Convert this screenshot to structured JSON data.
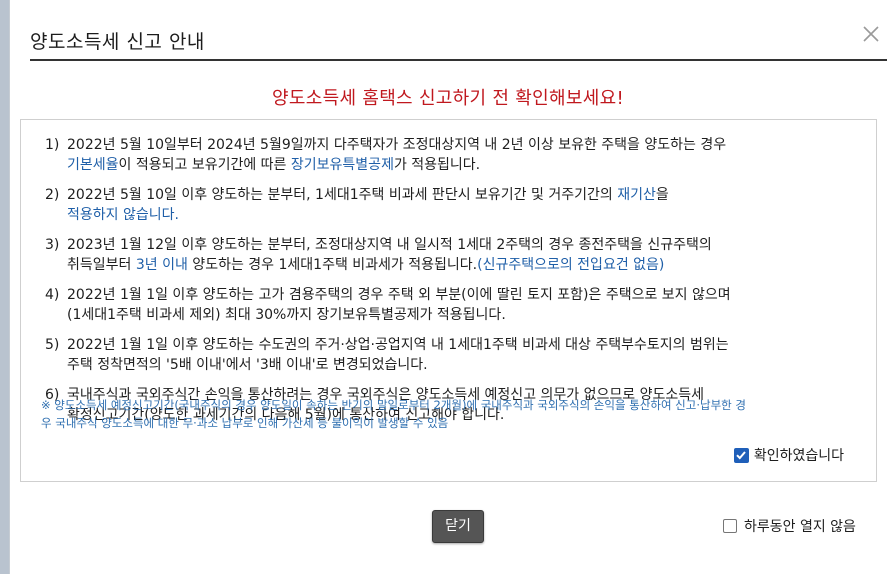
{
  "dialog": {
    "title": "양도소득세 신고 안내",
    "close_icon": "close-icon",
    "headline": "양도소득세 홈택스 신고하기 전 확인해보세요!"
  },
  "notices": [
    {
      "num": "1)",
      "line1": "2022년 5월 10일부터 2024년 5월9일까지 다주택자가 조정대상지역 내 2년 이상 보유한 주택을 양도하는 경우",
      "l2_blue1": "기본세율",
      "l2_plain1": "이 적용되고 보유기간에 따른 ",
      "l2_blue2": "장기보유특별공제",
      "l2_plain2": "가 적용됩니다."
    },
    {
      "num": "2)",
      "line1_plain": "2022년 5월 10일 이후 양도하는 분부터, 1세대1주택 비과세 판단시 보유기간 및 거주기간의 ",
      "line1_blue": "재기산",
      "line1_end": "을",
      "line2_blue": "적용하지 않습니다."
    },
    {
      "num": "3)",
      "line1": "2023년 1월 12일 이후 양도하는 분부터, 조정대상지역 내 일시적 1세대 2주택의 경우 종전주택을 신규주택의",
      "l2_plain1": "취득일부터 ",
      "l2_blue1": "3년 이내",
      "l2_plain2": " 양도하는 경우 1세대1주택 비과세가 적용됩니다.",
      "l2_blue2": "(신규주택으로의 전입요건 없음)"
    },
    {
      "num": "4)",
      "line1": "2022년 1월 1일 이후 양도하는 고가 겸용주택의 경우 주택 외 부분(이에 딸린 토지 포함)은 주택으로 보지 않으며",
      "line2": "(1세대1주택 비과세 제외) 최대 30%까지 장기보유특별공제가 적용됩니다."
    },
    {
      "num": "5)",
      "line1": "2022년 1월 1일 이후 양도하는 수도권의 주거·상업·공업지역 내 1세대1주택 비과세 대상 주택부수토지의 범위는",
      "line2": "주택 정착면적의 '5배 이내'에서 '3배 이내'로 변경되었습니다."
    },
    {
      "num": "6)",
      "line1": "국내주식과 국외주식간 손익을 통산하려는 경우 국외주식은 양도소득세 예정신고 의무가 없으므로 양도소득세",
      "line2": "확정신고기간(양도한 과세기간의 다음해 5월)에 통산하여 신고해야 합니다."
    }
  ],
  "footnote": {
    "line1": "※ 양도소득세 예정신고기간(국내주식의 경우 양도일이 속하는 반기의 말일로부터 2개월)에 국내주식과 국외주식의 손익을 통산하여 신고·납부한 경",
    "line2": "우 국내주식 양도소득에 대한 무·과소 납부로 인해 가산세 등 불이익이 발생할 수 있음"
  },
  "confirm_checkbox": {
    "label": "확인하였습니다",
    "checked": true
  },
  "close_button": {
    "label": "닫기"
  },
  "dont_show_checkbox": {
    "label": "하루동안 열지 않음",
    "checked": false
  },
  "colors": {
    "headline": "#c0181e",
    "highlight": "#1f5fa8",
    "checkbox": "#1f5fb9",
    "button": "#555555"
  }
}
